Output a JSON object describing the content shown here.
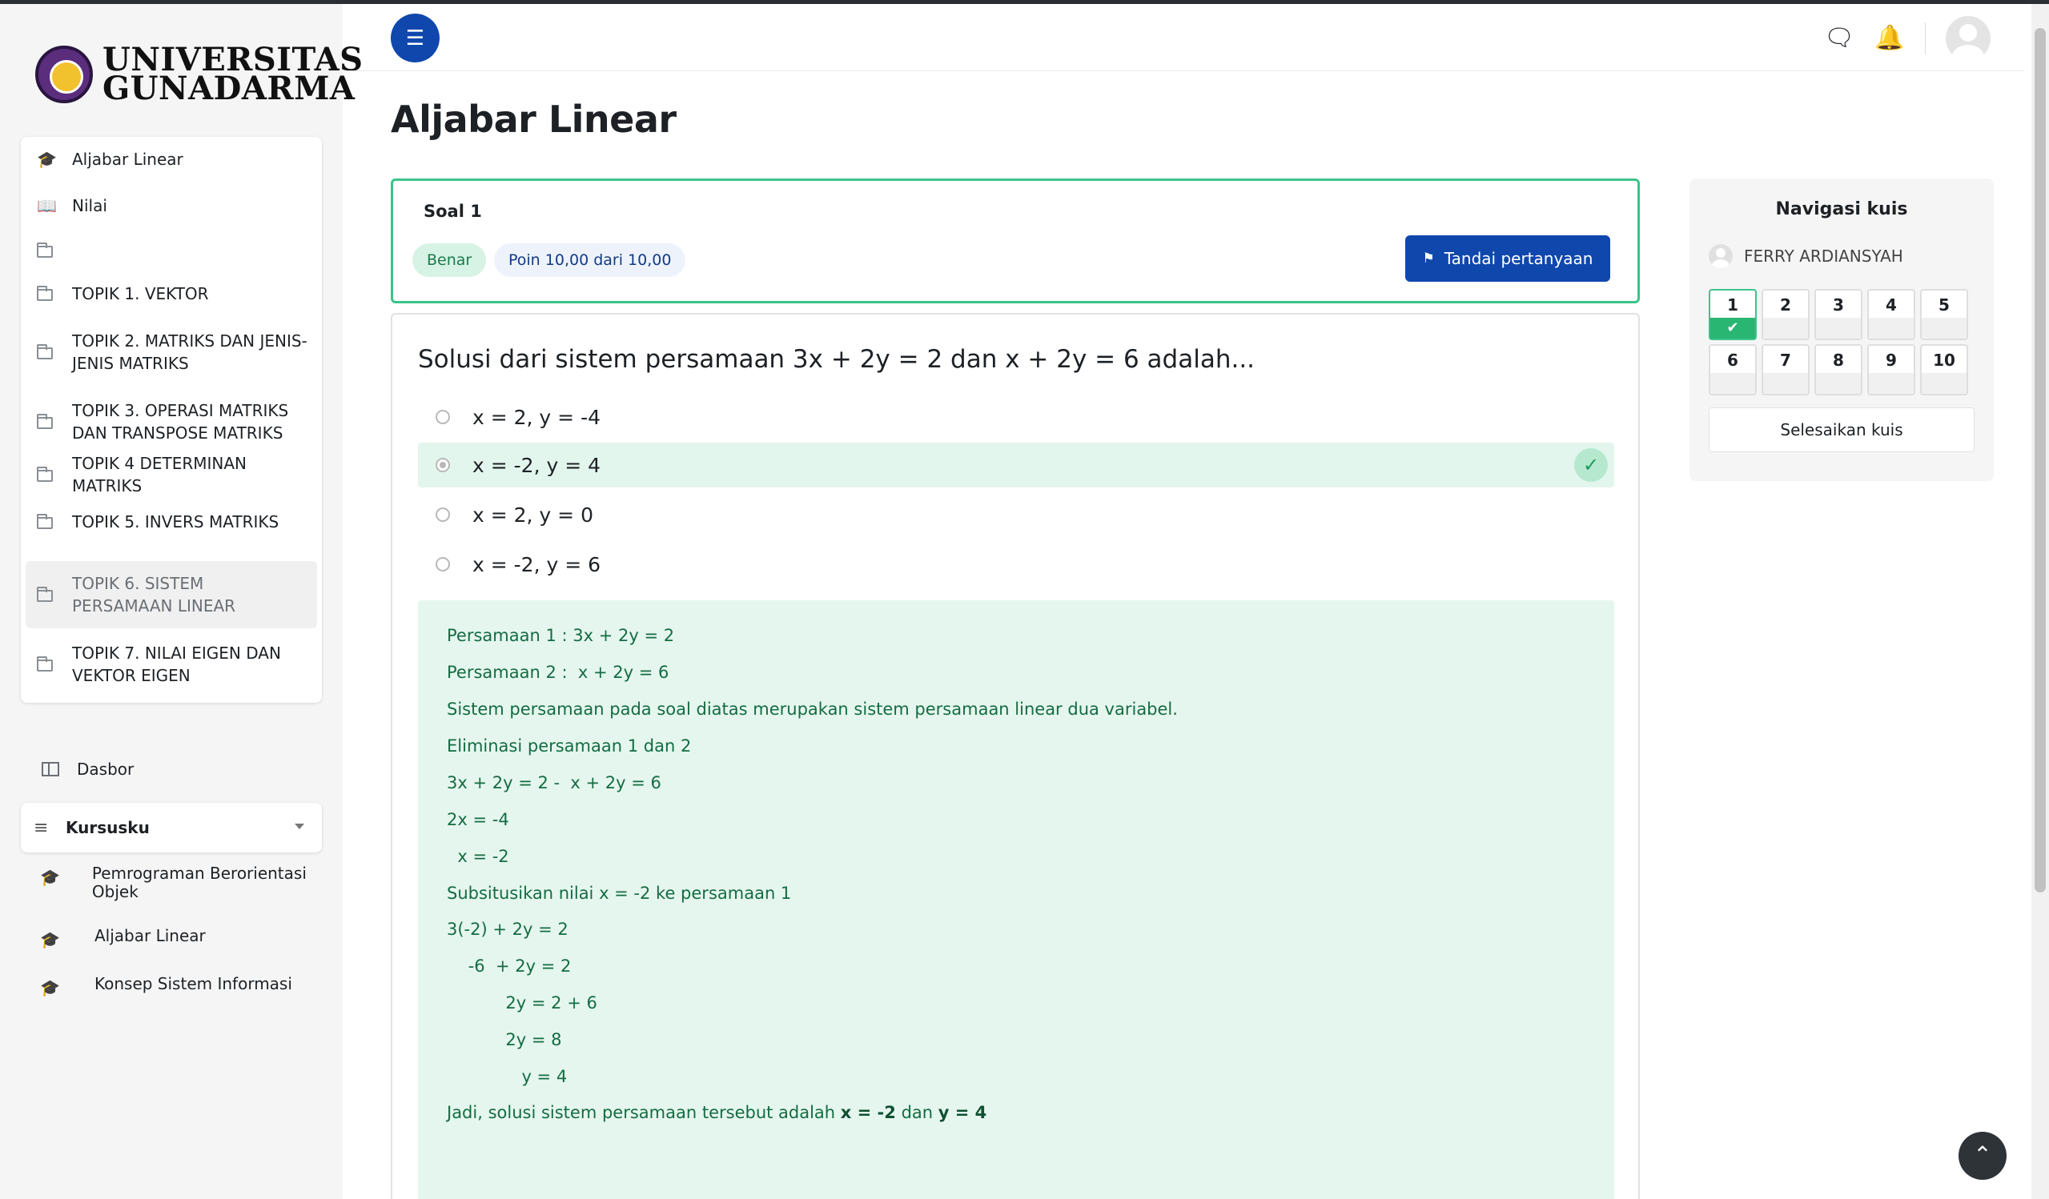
{
  "logo": {
    "line1": "UNIVERSITAS",
    "line2": "GUNADARMA"
  },
  "course_nav": [
    {
      "icon": "graduation-cap-icon",
      "label": "Aljabar Linear"
    },
    {
      "icon": "book-icon",
      "label": "Nilai"
    },
    {
      "icon": "folder-icon",
      "label": ""
    },
    {
      "icon": "folder-icon",
      "label": "TOPIK 1. VEKTOR"
    },
    {
      "icon": "folder-icon",
      "label": "TOPIK 2. MATRIKS DAN JENIS-JENIS MATRIKS"
    },
    {
      "icon": "folder-icon",
      "label": "TOPIK 3. OPERASI MATRIKS DAN TRANSPOSE MATRIKS"
    },
    {
      "icon": "folder-icon",
      "label": "TOPIK 4 DETERMINAN MATRIKS"
    },
    {
      "icon": "folder-icon",
      "label": "TOPIK 5. INVERS MATRIKS"
    },
    {
      "icon": "folder-icon",
      "label": "TOPIK 6. SISTEM PERSAMAAN LINEAR"
    },
    {
      "icon": "folder-icon",
      "label": "TOPIK 7. NILAI EIGEN DAN VEKTOR EIGEN"
    }
  ],
  "dasbor": {
    "label": "Dasbor"
  },
  "kursusku": {
    "label": "Kursusku",
    "items": [
      {
        "label": "Pemrograman Berorientasi Objek"
      },
      {
        "label": "Aljabar Linear"
      },
      {
        "label": "Konsep Sistem Informasi"
      }
    ]
  },
  "page_title": "Aljabar Linear",
  "question": {
    "number_label": "Soal 1",
    "status": "Benar",
    "points": "Poin 10,00 dari 10,00",
    "flag_label": "Tandai pertanyaan",
    "text": "Solusi dari sistem persamaan 3x + 2y = 2 dan x + 2y = 6 adalah...",
    "answers": [
      {
        "label": "x = 2, y = -4",
        "selected": false,
        "correct": false
      },
      {
        "label": "x = -2, y = 4",
        "selected": true,
        "correct": true
      },
      {
        "label": "x = 2, y = 0",
        "selected": false,
        "correct": false
      },
      {
        "label": "x = -2, y = 6",
        "selected": false,
        "correct": false
      }
    ],
    "feedback": [
      "Persamaan 1 : 3x + 2y = 2",
      "Persamaan 2 :  x + 2y = 6",
      "Sistem persamaan pada soal diatas merupakan sistem persamaan linear dua variabel.",
      "Eliminasi persamaan 1 dan 2",
      "3x + 2y = 2 -  x + 2y = 6",
      "2x = -4",
      "  x = -2",
      "Subsitusikan nilai x = -2 ke persamaan 1",
      "3(-2) + 2y = 2",
      "    -6  + 2y = 2",
      "           2y = 2 + 6",
      "           2y = 8",
      "              y = 4"
    ],
    "conclusion": {
      "prefix": "Jadi, solusi sistem persamaan tersebut adalah ",
      "x": "x = -2",
      "mid": " dan ",
      "y": "y = 4"
    }
  },
  "quiz_nav": {
    "title": "Navigasi kuis",
    "user": "FERRY ARDIANSYAH",
    "questions": [
      "1",
      "2",
      "3",
      "4",
      "5",
      "6",
      "7",
      "8",
      "9",
      "10"
    ],
    "answered": [
      "1"
    ],
    "finish_label": "Selesaikan kuis"
  },
  "colors": {
    "primary": "#0f47ad",
    "success": "#3bc48a",
    "feedback_bg": "#e5f6ee"
  }
}
